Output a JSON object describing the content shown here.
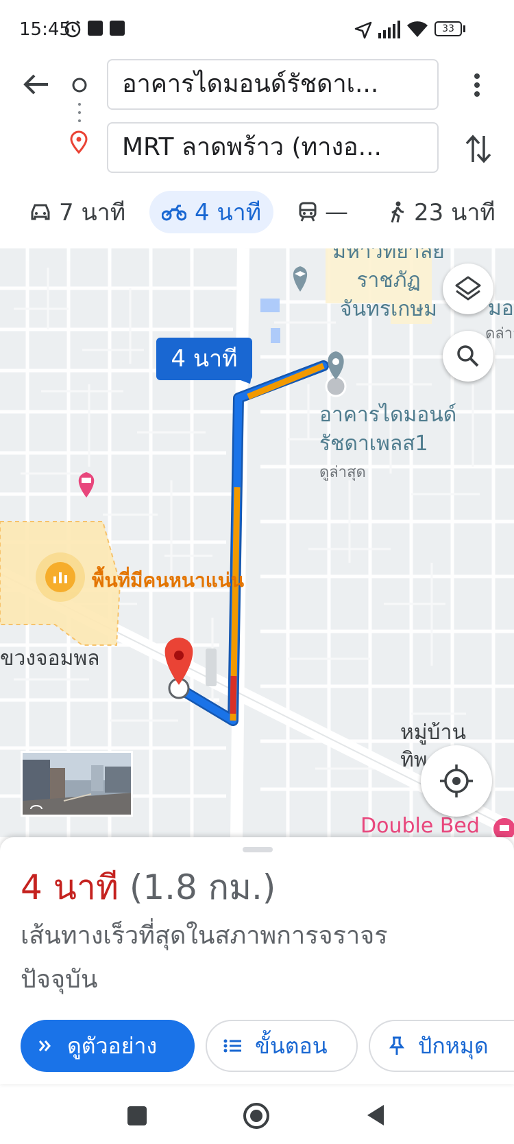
{
  "status_bar": {
    "time": "15:45",
    "battery": "33",
    "icons": [
      "alarm-icon",
      "notification-icon",
      "notification-icon",
      "location-arrow-icon",
      "signal-icon",
      "wifi-icon",
      "battery-icon"
    ]
  },
  "route": {
    "origin": "อาคารไดมอนด์รัชดาเ...",
    "destination": "MRT ลาดพร้าว (ทางอ..."
  },
  "modes": [
    {
      "icon": "car-icon",
      "label": "7 นาที",
      "selected": false
    },
    {
      "icon": "motorcycle-icon",
      "label": "4 นาที",
      "selected": true
    },
    {
      "icon": "train-icon",
      "label": "—",
      "selected": false
    },
    {
      "icon": "walk-icon",
      "label": "23 นาที",
      "selected": false
    }
  ],
  "map": {
    "route_time_callout": "4 นาที",
    "labels": {
      "university_line1": "มหาวิทยาลัย",
      "university_line2": "ราชภัฏ",
      "university_line3": "จันทรเกษม",
      "dest_line1": "อาคารไดมอนด์",
      "dest_line2": "รัชดาเพลส1",
      "dest_line3": "ดูล่าสุด",
      "right_edge_top": "มอ",
      "right_edge_sub": "ดล่าสุ",
      "crowded": "พื้นที่มีคนหนาแน่น",
      "road": "ขวงจอมพล",
      "village_line1": "หมู่บ้าน",
      "village_line2": "ทิพ",
      "hotel": "Double Bed"
    },
    "colors": {
      "route_blue": "#1a73e8",
      "route_orange": "#f29900",
      "route_red": "#d93025",
      "pin_red": "#ea4335",
      "label_teal": "#4f7c8e",
      "hotel_pink": "#e8467c",
      "crowd_orange": "#e37400"
    }
  },
  "summary": {
    "duration": "4 นาที",
    "distance": "(1.8 กม.)",
    "description": "เส้นทางเร็วที่สุดในสภาพการจราจรปัจจุบัน"
  },
  "actions": {
    "preview": "ดูตัวอย่าง",
    "steps": "ขั้นตอน",
    "pin": "ปักหมุด"
  },
  "colors": {
    "accent": "#1a73e8",
    "time_red": "#c5221f",
    "selected_bg": "#e8f0fe"
  }
}
